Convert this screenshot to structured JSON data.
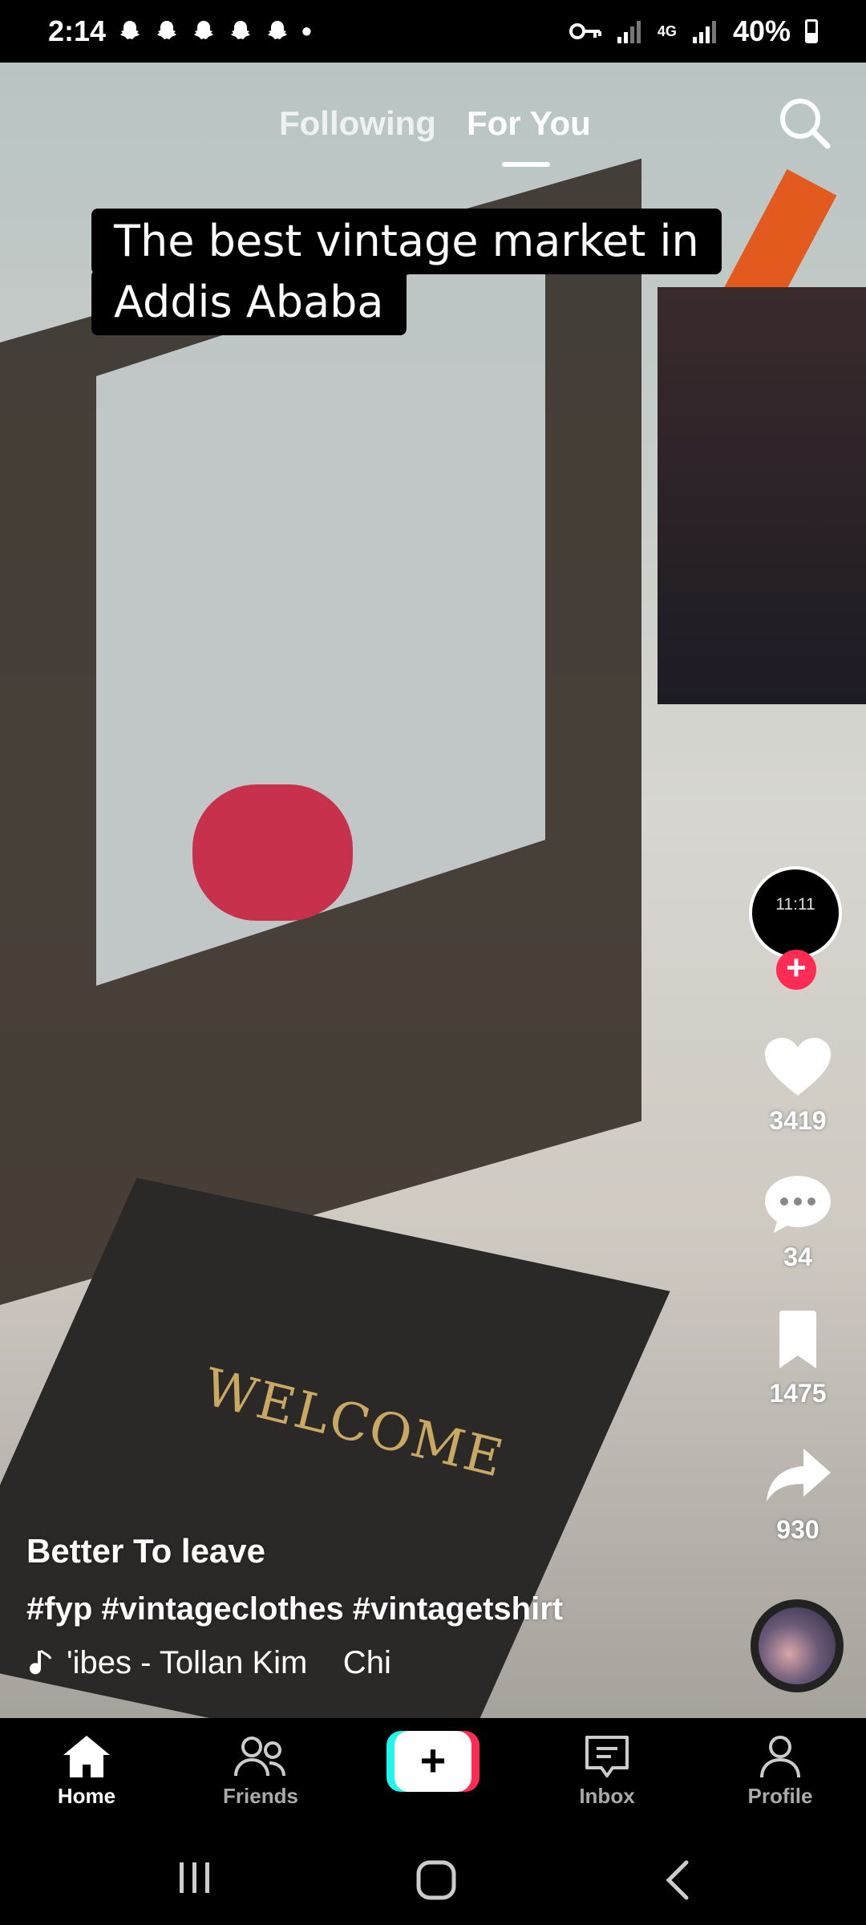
{
  "status_bar": {
    "time": "2:14",
    "notification_icons": [
      "snapchat-icon",
      "snapchat-icon",
      "snapchat-icon",
      "snapchat-icon",
      "snapchat-icon"
    ],
    "dot": "•",
    "network": "4G",
    "battery": "40%"
  },
  "top_tabs": {
    "following": "Following",
    "for_you": "For You",
    "active": "For You"
  },
  "caption": {
    "line1": "The best vintage market in",
    "line2": "Addis Ababa"
  },
  "scene_text": {
    "mat": "WELCOME"
  },
  "creator_avatar": {
    "time": "11:11"
  },
  "actions": {
    "likes": "3419",
    "comments": "34",
    "saves": "1475",
    "shares": "930"
  },
  "post": {
    "author": "Better To leave",
    "description": "#fyp #vintageclothes #vintagetshirt",
    "sound": "'ibes - Tollan Kim    Chi"
  },
  "bottom_nav": {
    "home": "Home",
    "friends": "Friends",
    "create": "+",
    "inbox": "Inbox",
    "profile": "Profile",
    "active": "Home"
  },
  "colors": {
    "accent_red": "#fe2c55",
    "accent_cyan": "#25f4ee"
  }
}
